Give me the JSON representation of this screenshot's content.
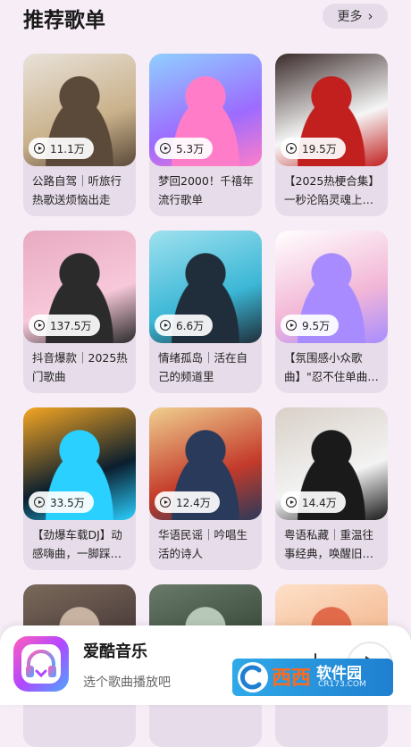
{
  "header": {
    "title": "推荐歌单",
    "more_label": "更多"
  },
  "playlists": [
    {
      "plays": "11.1万",
      "title": "公路自驾｜听旅行热歌送烦恼出走",
      "cover": [
        "#c9b18a",
        "#5b4a3a",
        "#e9e2da"
      ]
    },
    {
      "plays": "5.3万",
      "title": "梦回2000！千禧年流行歌单",
      "cover": [
        "#9c6bff",
        "#ff7dc8",
        "#8fd0ff"
      ]
    },
    {
      "plays": "19.5万",
      "title": "【2025热梗合集】一秒沦陷灵魂上…",
      "cover": [
        "#f6f6f6",
        "#c21f1f",
        "#3b2b2b"
      ]
    },
    {
      "plays": "137.5万",
      "title": "抖音爆款｜2025热门歌曲",
      "cover": [
        "#f7c8d9",
        "#2b2b2b",
        "#e8aac2"
      ]
    },
    {
      "plays": "6.6万",
      "title": "情绪孤岛｜活在自己的频道里",
      "cover": [
        "#3bb7d6",
        "#1f2e3a",
        "#9fe1ef"
      ]
    },
    {
      "plays": "9.5万",
      "title": "【氛围感小众歌曲】\"忍不住单曲…",
      "cover": [
        "#f2b6d6",
        "#a88cff",
        "#ffffff"
      ]
    },
    {
      "plays": "33.5万",
      "title": "【劲爆车载DJ】动感嗨曲，一脚踩…",
      "cover": [
        "#0b1e2e",
        "#2ad0ff",
        "#f5a623"
      ]
    },
    {
      "plays": "12.4万",
      "title": "华语民谣｜吟唱生活的诗人",
      "cover": [
        "#c43a2a",
        "#2a3a5a",
        "#f0d090"
      ]
    },
    {
      "plays": "14.4万",
      "title": "粤语私藏｜重温往事经典，唤醒旧…",
      "cover": [
        "#f3f3f3",
        "#1a1a1a",
        "#d9d0c8"
      ]
    },
    {
      "plays": "",
      "title": "",
      "cover": [
        "#4a3a3a",
        "#c8b2a2",
        "#7a6a5a"
      ]
    },
    {
      "plays": "",
      "title": "",
      "cover": [
        "#3a4a3a",
        "#b8c8b8",
        "#6a7a6a"
      ]
    },
    {
      "plays": "",
      "title": "",
      "cover": [
        "#f4b890",
        "#e06a4a",
        "#fde0c8"
      ]
    }
  ],
  "player": {
    "app_name": "爱酷音乐",
    "hint": "选个歌曲播放吧"
  },
  "watermark": {
    "brand": "西西",
    "name": "软件园",
    "url": "CR173.COM"
  },
  "colors": {
    "background": "#f6edf7",
    "card": "#e7dce9",
    "accent": "#b246ff"
  }
}
